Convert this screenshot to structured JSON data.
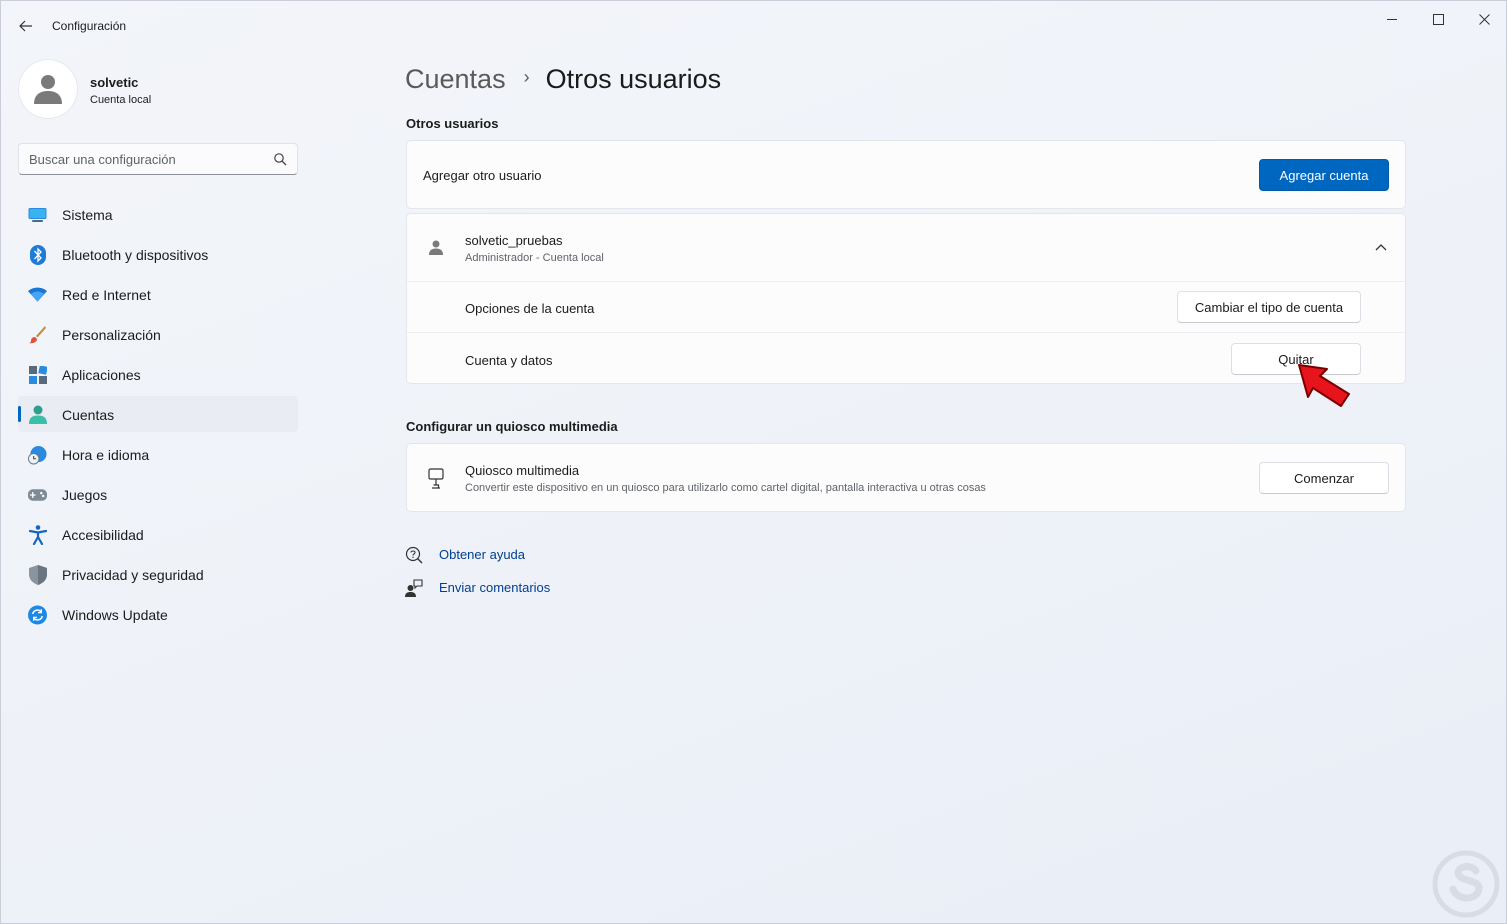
{
  "window": {
    "title": "Configuración"
  },
  "profile": {
    "name": "solvetic",
    "type": "Cuenta local"
  },
  "search": {
    "placeholder": "Buscar una configuración"
  },
  "sidebar": {
    "items": [
      {
        "label": "Sistema",
        "icon": "monitor-icon"
      },
      {
        "label": "Bluetooth y dispositivos",
        "icon": "bluetooth-icon"
      },
      {
        "label": "Red e Internet",
        "icon": "wifi-icon"
      },
      {
        "label": "Personalización",
        "icon": "brush-icon"
      },
      {
        "label": "Aplicaciones",
        "icon": "apps-icon"
      },
      {
        "label": "Cuentas",
        "icon": "person-icon",
        "active": true
      },
      {
        "label": "Hora e idioma",
        "icon": "clock-globe-icon"
      },
      {
        "label": "Juegos",
        "icon": "gamepad-icon"
      },
      {
        "label": "Accesibilidad",
        "icon": "accessibility-icon"
      },
      {
        "label": "Privacidad y seguridad",
        "icon": "shield-icon"
      },
      {
        "label": "Windows Update",
        "icon": "sync-icon"
      }
    ]
  },
  "breadcrumb": {
    "parent": "Cuentas",
    "separator": "›",
    "current": "Otros usuarios"
  },
  "other_users": {
    "section_title": "Otros usuarios",
    "add_user_label": "Agregar otro usuario",
    "add_account_button": "Agregar cuenta",
    "user": {
      "name": "solvetic_pruebas",
      "role": "Administrador - Cuenta local",
      "account_options_label": "Opciones de la cuenta",
      "change_type_button": "Cambiar el tipo de cuenta",
      "account_data_label": "Cuenta y datos",
      "remove_button": "Quitar"
    }
  },
  "kiosk": {
    "section_title": "Configurar un quiosco multimedia",
    "title": "Quiosco multimedia",
    "description": "Convertir este dispositivo en un quiosco para utilizarlo como cartel digital, pantalla interactiva u otras cosas",
    "start_button": "Comenzar"
  },
  "links": {
    "help": "Obtener ayuda",
    "feedback": "Enviar comentarios"
  },
  "colors": {
    "accent": "#0067c0",
    "pointer": "#e8141b"
  }
}
